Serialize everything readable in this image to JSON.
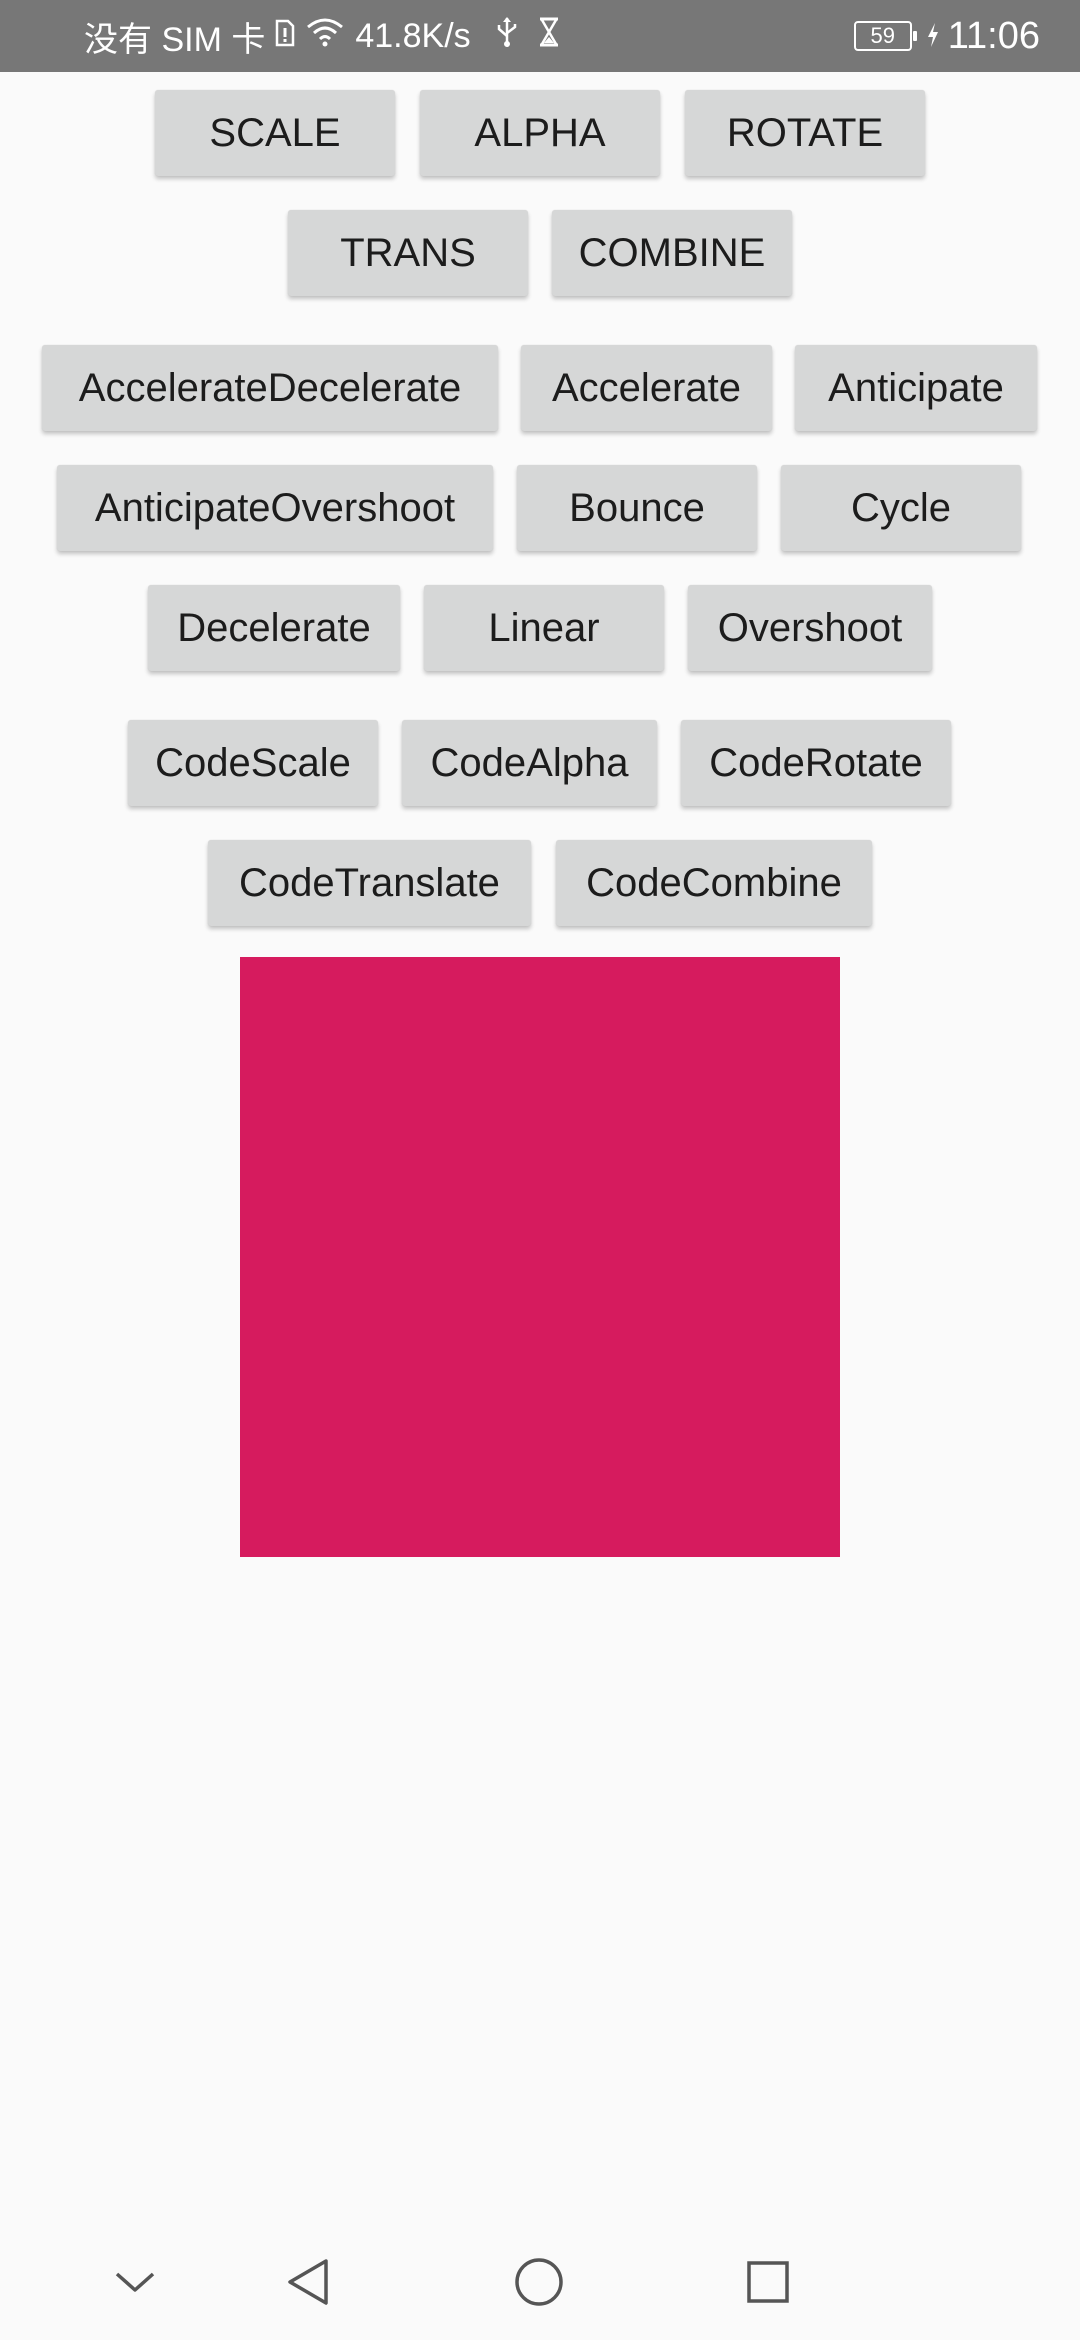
{
  "status_bar": {
    "carrier": "没有 SIM 卡",
    "speed": "41.8K/s",
    "battery_level": "59",
    "time": "11:06",
    "icons": [
      "sim-icon",
      "wifi-icon",
      "usb-icon",
      "hourglass-icon",
      "battery-icon",
      "charging-icon"
    ]
  },
  "animation_buttons": {
    "row1": [
      "SCALE",
      "ALPHA",
      "ROTATE"
    ],
    "row2": [
      "TRANS",
      "COMBINE"
    ]
  },
  "interpolator_buttons": {
    "row1": [
      "AccelerateDecelerate",
      "Accelerate",
      "Anticipate"
    ],
    "row2": [
      "AnticipateOvershoot",
      "Bounce",
      "Cycle"
    ],
    "row3": [
      "Decelerate",
      "Linear",
      "Overshoot"
    ]
  },
  "code_buttons": {
    "row1": [
      "CodeScale",
      "CodeAlpha",
      "CodeRotate"
    ],
    "row2": [
      "CodeTranslate",
      "CodeCombine"
    ]
  },
  "animation_target": {
    "color": "#d61b5e"
  },
  "nav_bar": {
    "icons": [
      "collapse-icon",
      "back-icon",
      "home-icon",
      "recents-icon"
    ]
  },
  "colors": {
    "status_bar_bg": "#777777",
    "button_bg": "#d6d7d7",
    "page_bg": "#fafafa",
    "accent": "#d61b5e"
  }
}
